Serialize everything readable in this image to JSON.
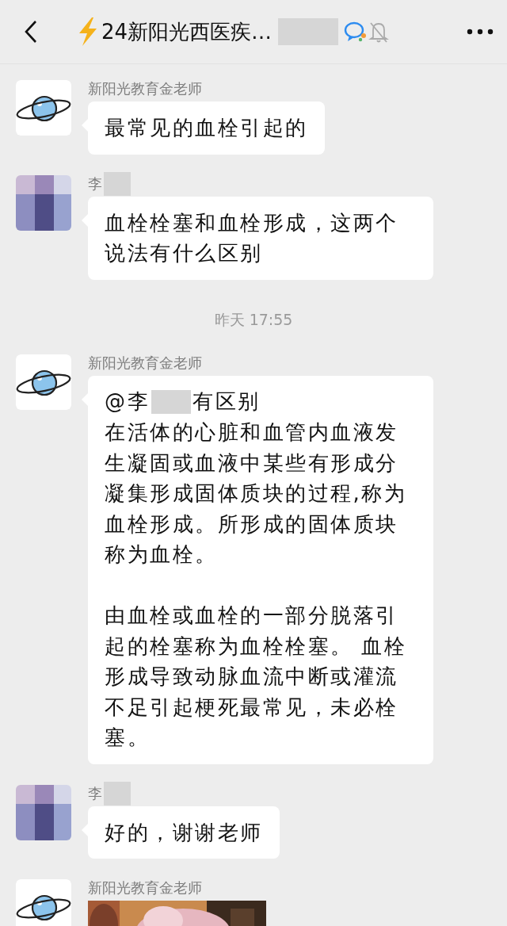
{
  "header": {
    "title": "24新阳光西医疾…",
    "title_redacted": true,
    "muted": true
  },
  "items": [
    {
      "kind": "text",
      "sender": "新阳光教育金老师",
      "sender_redacted": false,
      "avatar_blurred": false,
      "paragraphs": [
        "最常见的血栓引起的"
      ]
    },
    {
      "kind": "text",
      "sender": "李",
      "sender_redacted": true,
      "avatar_blurred": true,
      "paragraphs": [
        "血栓栓塞和血栓形成，这两个说法有什么区别"
      ]
    },
    {
      "kind": "time",
      "text": "昨天 17:55"
    },
    {
      "kind": "text",
      "sender": "新阳光教育金老师",
      "sender_redacted": false,
      "avatar_blurred": false,
      "mention": "@李",
      "mention_redacted": true,
      "mention_rest": "有区别",
      "paragraphs": [
        "在活体的心脏和血管内血液发生凝固或血液中某些有形成分凝集形成固体质块的过程,称为血栓形成。所形成的固体质块称为血栓。",
        "由血栓或血栓的一部分脱落引起的栓塞称为血栓栓塞。 血栓形成导致动脉血流中断或灌流不足引起梗死最常见，未必栓塞。"
      ]
    },
    {
      "kind": "text",
      "sender": "李",
      "sender_redacted": true,
      "avatar_blurred": true,
      "paragraphs": [
        "好的，谢谢老师"
      ]
    },
    {
      "sender": "新阳光教育金老师",
      "sender_redacted": false,
      "avatar_blurred": false
    }
  ]
}
